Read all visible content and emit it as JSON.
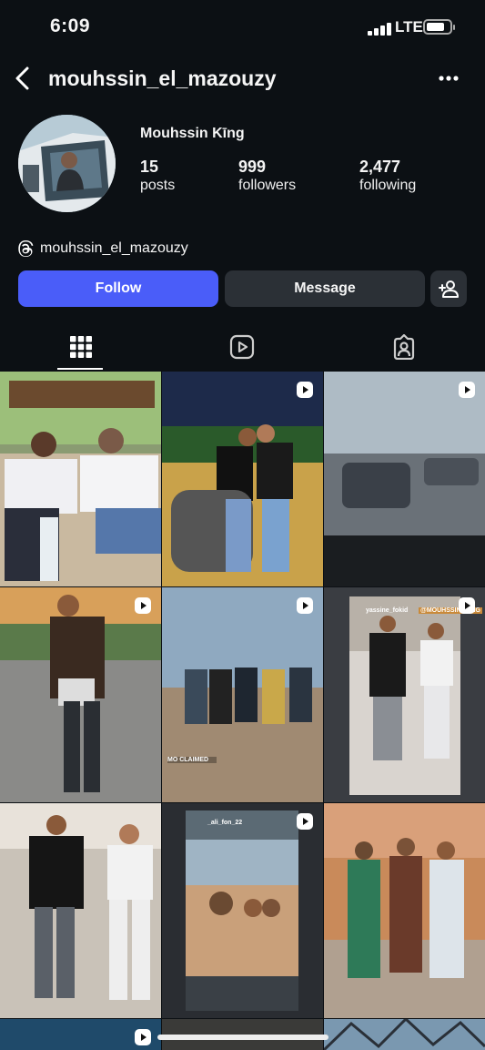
{
  "status_bar": {
    "time": "6:09",
    "network": "LTE",
    "battery_level": 0.8
  },
  "header": {
    "username": "mouhssin_el_mazouzy",
    "back_icon": "chevron-left-icon",
    "more_icon": "more-horizontal-icon"
  },
  "profile": {
    "display_name": "Mouhssin Kīng",
    "stats": [
      {
        "value": "15",
        "label": "posts"
      },
      {
        "value": "999",
        "label": "followers"
      },
      {
        "value": "2,477",
        "label": "following"
      }
    ],
    "threads_handle": "mouhssin_el_mazouzy"
  },
  "actions": {
    "follow_label": "Follow",
    "message_label": "Message",
    "suggest_icon": "add-person-icon"
  },
  "tabs": [
    {
      "name": "posts",
      "icon": "grid-icon",
      "active": true
    },
    {
      "name": "reels",
      "icon": "reels-icon",
      "active": false
    },
    {
      "name": "tagged",
      "icon": "tagged-icon",
      "active": false
    }
  ],
  "grid_labels": {
    "post5_caption": "MO CLAIMED",
    "post6_tag_left": "yassine_fokid",
    "post6_tag_right": "@MOUHSSIN_KING",
    "post8_tag": "_ali_fon_22"
  },
  "colors": {
    "background": "#0c1014",
    "follow_button": "#4a5df9",
    "secondary_button": "#2b3036"
  }
}
